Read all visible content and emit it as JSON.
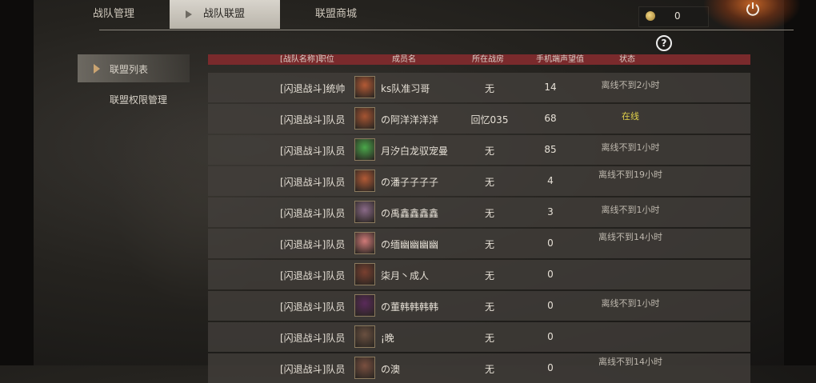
{
  "tabs": [
    "战队管理",
    "战队联盟",
    "联盟商城"
  ],
  "coins": "0",
  "help": "?",
  "menu": [
    "联盟列表",
    "联盟权限管理"
  ],
  "table": {
    "headers": [
      "[战队名称]职位",
      "成员名",
      "所在战房",
      "手机端声望值",
      "状态"
    ],
    "rows": [
      {
        "position": "[闪退战斗]统帅",
        "name": "ks队准习哥",
        "region": "无",
        "power": "14",
        "status": "离线不到2小时",
        "avatar_color": "#b45a35"
      },
      {
        "position": "[闪退战斗]队员",
        "name": "の阿洋洋洋洋",
        "region": "回忆035",
        "power": "68",
        "status": "在线",
        "avatar_color": "#a65432"
      },
      {
        "position": "[闪退战斗]队员",
        "name": "月汐白龙驭宠曼",
        "region": "无",
        "power": "85",
        "status": "离线不到1小时",
        "avatar_color": "#4aa84a"
      },
      {
        "position": "[闪退战斗]队员",
        "name": "の潘子子子子",
        "region": "无",
        "power": "4",
        "status": "离线不到19小时",
        "avatar_color": "#b25a36"
      },
      {
        "position": "[闪退战斗]队员",
        "name": "の禹鑫鑫鑫鑫",
        "region": "无",
        "power": "3",
        "status": "离线不到1小时",
        "avatar_color": "#8a6a88"
      },
      {
        "position": "[闪退战斗]队员",
        "name": "の缅幽幽幽幽",
        "region": "无",
        "power": "0",
        "status": "离线不到14小时",
        "avatar_color": "#d07a78"
      },
      {
        "position": "[闪退战斗]队员",
        "name": "柒月丶成人",
        "region": "无",
        "power": "0",
        "status": "",
        "avatar_color": "#7a4030"
      },
      {
        "position": "[闪退战斗]队员",
        "name": "の董韩韩韩韩",
        "region": "无",
        "power": "0",
        "status": "离线不到1小时",
        "avatar_color": "#5a2a5a"
      },
      {
        "position": "[闪退战斗]队员",
        "name": "¡晚",
        "region": "无",
        "power": "0",
        "status": "",
        "avatar_color": "#6a5040"
      },
      {
        "position": "[闪退战斗]队员",
        "name": "の澳",
        "region": "无",
        "power": "0",
        "status": "离线不到14小时",
        "avatar_color": "#7a5040"
      }
    ]
  }
}
